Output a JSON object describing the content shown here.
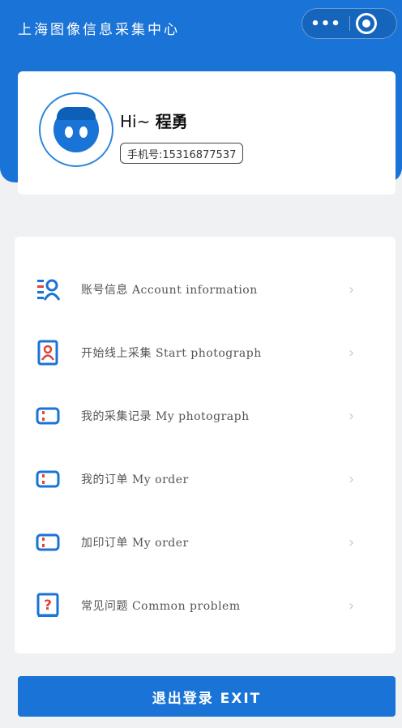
{
  "header": {
    "app_title": "上海图像信息采集中心",
    "capsule_more_icon": "more-dots-icon",
    "capsule_close_icon": "target-close-icon"
  },
  "profile": {
    "greeting_prefix": "Hi~",
    "user_name": "程勇",
    "phone": "手机号:15316877537",
    "avatar_icon": "user-avatar-icon"
  },
  "menu": {
    "items": [
      {
        "label": "账号信息 Account information",
        "icon": "account-info-icon"
      },
      {
        "label": "开始线上采集 Start photograph",
        "icon": "portrait-icon"
      },
      {
        "label": "我的采集记录 My photograph",
        "icon": "ticket-icon"
      },
      {
        "label": "我的订单 My order",
        "icon": "ticket-icon"
      },
      {
        "label": "加印订单 My order",
        "icon": "ticket-icon"
      },
      {
        "label": "常见问题 Common problem",
        "icon": "question-book-icon"
      }
    ],
    "arrow": "›"
  },
  "footer": {
    "exit_label": "退出登录 EXIT"
  },
  "colors": {
    "primary": "#1a73d6",
    "background": "#f0f1f3",
    "card": "#ffffff",
    "icon_red": "#e0443a"
  }
}
